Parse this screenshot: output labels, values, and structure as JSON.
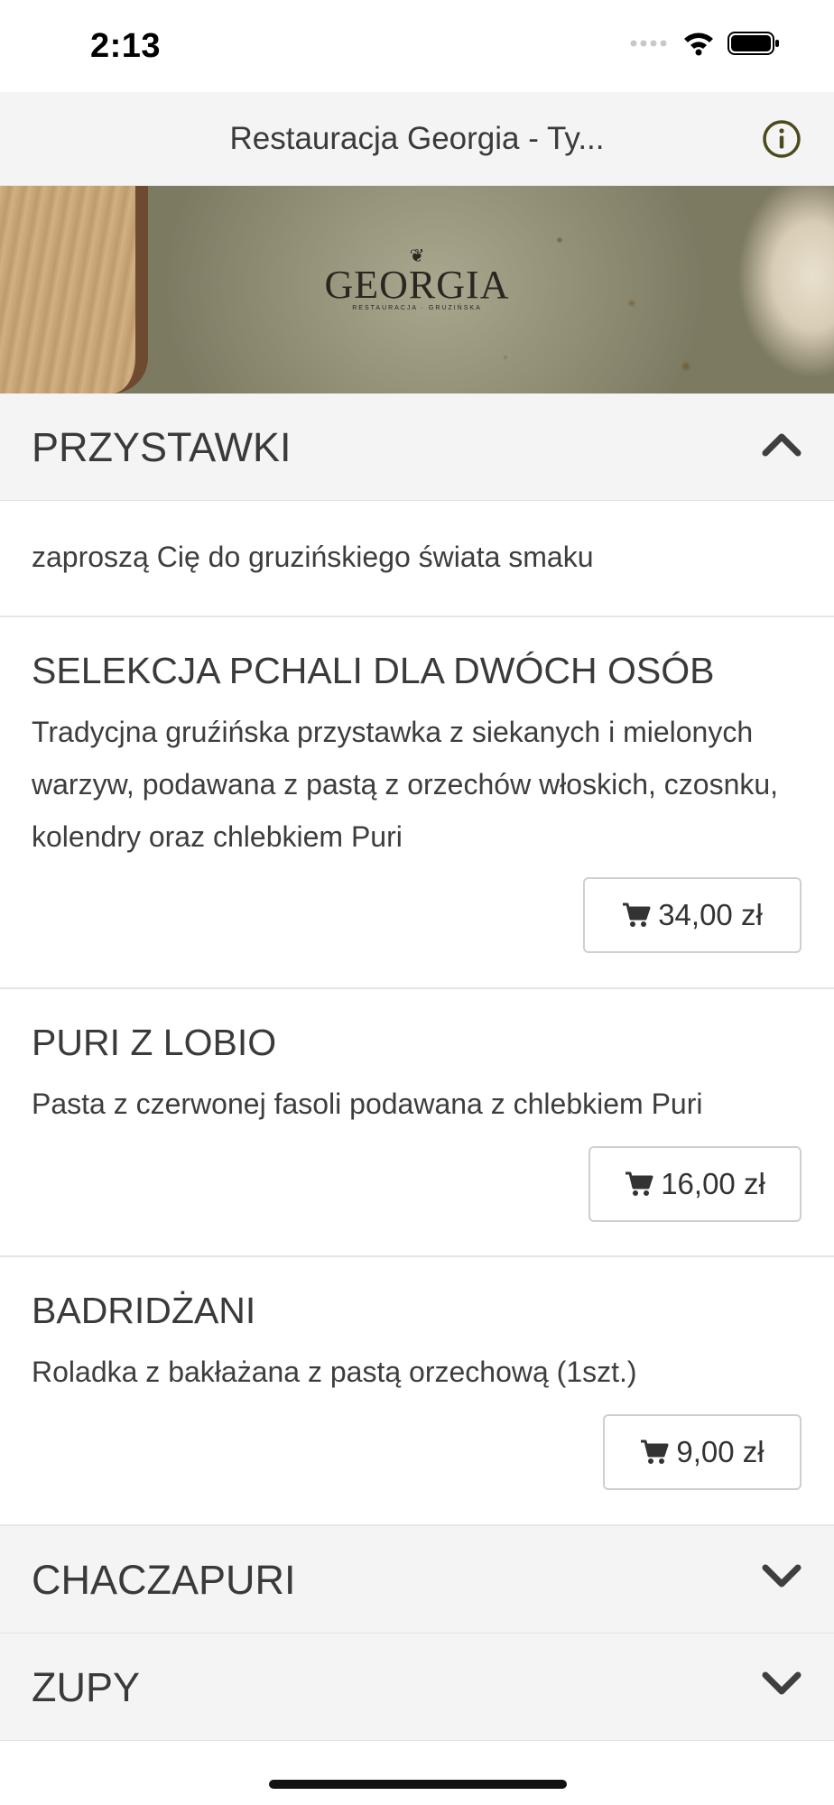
{
  "status": {
    "time": "2:13"
  },
  "nav": {
    "title": "Restauracja Georgia - Ty..."
  },
  "banner": {
    "logo_text": "GEORGIA",
    "logo_sub": "RESTAURACJA · GRUZIŃSKA"
  },
  "sections": {
    "starters": {
      "title": "PRZYSTAWKI",
      "intro": "zaproszą Cię do gruzińskiego świata smaku",
      "items": [
        {
          "name": "SELEKCJA PCHALI DLA DWÓCH OSÓB",
          "description": "Tradycjna gruźińska przystawka z siekanych i mielonych warzyw, podawana z pastą z orzechów włoskich, czosnku, kolendry oraz chlebkiem Puri",
          "price": "34,00 zł"
        },
        {
          "name": "PURI Z LOBIO",
          "description": "Pasta z czerwonej fasoli podawana z chlebkiem Puri",
          "price": "16,00 zł"
        },
        {
          "name": "BADRIDŻANI",
          "description": "Roladka z bakłażana z pastą orzechową (1szt.)",
          "price": "9,00 zł"
        }
      ]
    },
    "khachapuri": {
      "title": "CHACZAPURI"
    },
    "soups": {
      "title": "ZUPY"
    }
  }
}
